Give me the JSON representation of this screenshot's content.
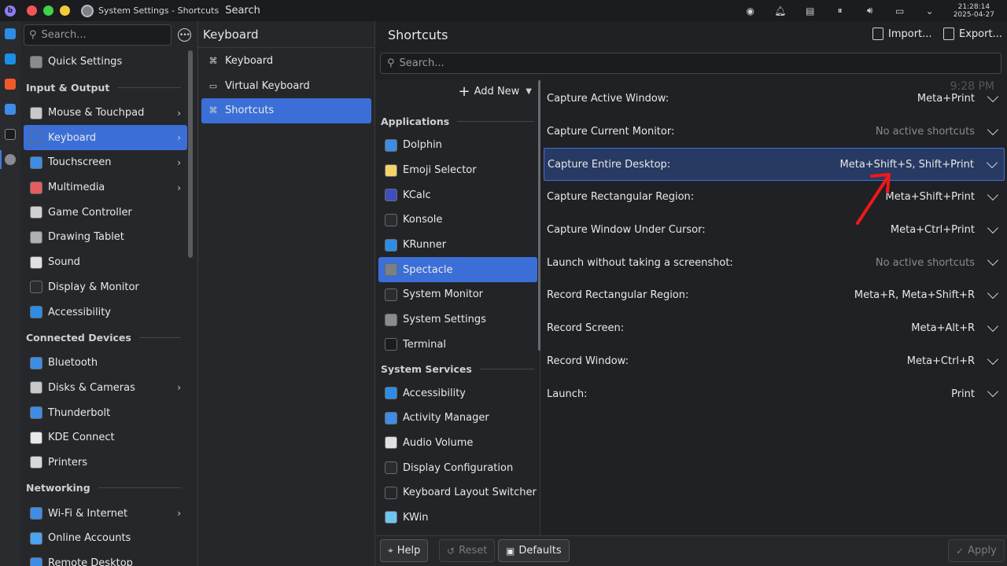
{
  "topbar": {
    "window_title": "System Settings - Shortcuts",
    "search_label": "Search",
    "clock_time": "21:28:14",
    "clock_date": "2025-04-27"
  },
  "sidebar": {
    "search_placeholder": "Search...",
    "items": [
      {
        "type": "item",
        "label": "Quick Settings",
        "color": "#8a8b8f"
      },
      {
        "type": "header",
        "label": "Input & Output"
      },
      {
        "type": "item",
        "label": "Mouse & Touchpad",
        "color": "#c8c8c8",
        "chevron": true
      },
      {
        "type": "item",
        "label": "Keyboard",
        "color": "#3b6fd7",
        "chevron": true,
        "selected": true
      },
      {
        "type": "item",
        "label": "Touchscreen",
        "color": "#3d8de6",
        "chevron": true
      },
      {
        "type": "item",
        "label": "Multimedia",
        "color": "#e65d5d",
        "chevron": true
      },
      {
        "type": "item",
        "label": "Game Controller",
        "color": "#d0d0d0"
      },
      {
        "type": "item",
        "label": "Drawing Tablet",
        "color": "#b0b0b0"
      },
      {
        "type": "item",
        "label": "Sound",
        "color": "#e0e0e0"
      },
      {
        "type": "item",
        "label": "Display & Monitor",
        "color": "#2b2c30"
      },
      {
        "type": "item",
        "label": "Accessibility",
        "color": "#2d8de6"
      },
      {
        "type": "header",
        "label": "Connected Devices"
      },
      {
        "type": "item",
        "label": "Bluetooth",
        "color": "#3d8de6"
      },
      {
        "type": "item",
        "label": "Disks & Cameras",
        "color": "#c8c8c8",
        "chevron": true
      },
      {
        "type": "item",
        "label": "Thunderbolt",
        "color": "#3d8de6"
      },
      {
        "type": "item",
        "label": "KDE Connect",
        "color": "#e8e8e8"
      },
      {
        "type": "item",
        "label": "Printers",
        "color": "#d8d8d8"
      },
      {
        "type": "header",
        "label": "Networking"
      },
      {
        "type": "item",
        "label": "Wi-Fi & Internet",
        "color": "#3d8de6",
        "chevron": true
      },
      {
        "type": "item",
        "label": "Online Accounts",
        "color": "#4aa3f0"
      },
      {
        "type": "item",
        "label": "Remote Desktop",
        "color": "#3d8de6"
      }
    ]
  },
  "keyboard_panel": {
    "title": "Keyboard",
    "items": [
      {
        "label": "Keyboard",
        "icon": "⌘"
      },
      {
        "label": "Virtual Keyboard",
        "icon": "▭"
      },
      {
        "label": "Shortcuts",
        "icon": "⌘",
        "selected": true
      }
    ]
  },
  "shortcuts": {
    "title": "Shortcuts",
    "import_label": "Import...",
    "export_label": "Export...",
    "search_placeholder": "Search...",
    "ghost_time": "9:28 PM",
    "add_new_label": "Add New",
    "groups": [
      {
        "header": "Applications",
        "items": [
          {
            "label": "Dolphin",
            "color": "#3d8de6"
          },
          {
            "label": "Emoji Selector",
            "color": "#f5d36b"
          },
          {
            "label": "KCalc",
            "color": "#3d4fbf"
          },
          {
            "label": "Konsole",
            "color": "#2b2c30"
          },
          {
            "label": "KRunner",
            "color": "#2d8de6"
          },
          {
            "label": "Spectacle",
            "color": "#7d8086",
            "selected": true
          },
          {
            "label": "System Monitor",
            "color": "#2b2c30"
          },
          {
            "label": "System Settings",
            "color": "#8a8b8f"
          },
          {
            "label": "Terminal",
            "color": "#1b1c1f"
          }
        ]
      },
      {
        "header": "System Services",
        "items": [
          {
            "label": "Accessibility",
            "color": "#2d8de6"
          },
          {
            "label": "Activity Manager",
            "color": "#3d8de6"
          },
          {
            "label": "Audio Volume",
            "color": "#e0e0e0"
          },
          {
            "label": "Display Configuration",
            "color": "#2b2c30"
          },
          {
            "label": "Keyboard Layout Switcher",
            "color": "#26272a"
          },
          {
            "label": "KWin",
            "color": "#6cc6f0"
          }
        ]
      }
    ],
    "rows": [
      {
        "label": "Capture Active Window:",
        "keys": "Meta+Print"
      },
      {
        "label": "Capture Current Monitor:",
        "keys": "No active shortcuts",
        "none": true
      },
      {
        "label": "Capture Entire Desktop:",
        "keys": "Meta+Shift+S, Shift+Print",
        "selected": true
      },
      {
        "label": "Capture Rectangular Region:",
        "keys": "Meta+Shift+Print"
      },
      {
        "label": "Capture Window Under Cursor:",
        "keys": "Meta+Ctrl+Print"
      },
      {
        "label": "Launch without taking a screenshot:",
        "keys": "No active shortcuts",
        "none": true
      },
      {
        "label": "Record Rectangular Region:",
        "keys": "Meta+R, Meta+Shift+R"
      },
      {
        "label": "Record Screen:",
        "keys": "Meta+Alt+R"
      },
      {
        "label": "Record Window:",
        "keys": "Meta+Ctrl+R"
      },
      {
        "label": "Launch:",
        "keys": "Print"
      }
    ],
    "buttons": {
      "help": "Help",
      "reset": "Reset",
      "defaults": "Defaults",
      "apply": "Apply"
    }
  }
}
